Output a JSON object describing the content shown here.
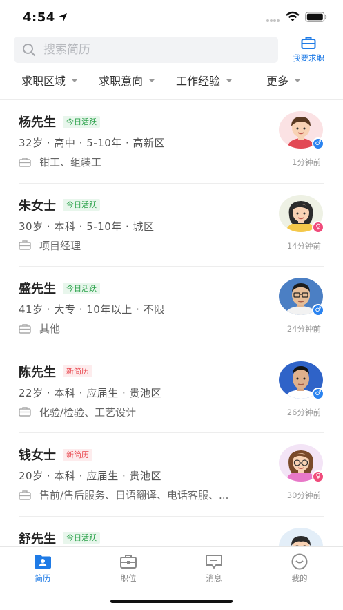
{
  "status_bar": {
    "time": "4:54"
  },
  "search": {
    "placeholder": "搜索简历"
  },
  "header_action": {
    "label": "我要求职"
  },
  "filters": [
    "求职区域",
    "求职意向",
    "工作经验",
    "更多"
  ],
  "candidates": [
    {
      "name": "杨先生",
      "tag": "今日活跃",
      "tag_type": "active",
      "info": "32岁 · 高中 · 5-10年 · 高新区",
      "job": "钳工、组装工",
      "time": "1分钟前",
      "gender": "male",
      "gender_symbol": "♂"
    },
    {
      "name": "朱女士",
      "tag": "今日活跃",
      "tag_type": "active",
      "info": "30岁 · 本科 · 5-10年 · 城区",
      "job": "项目经理",
      "time": "14分钟前",
      "gender": "female",
      "gender_symbol": "♀"
    },
    {
      "name": "盛先生",
      "tag": "今日活跃",
      "tag_type": "active",
      "info": "41岁 · 大专 · 10年以上 · 不限",
      "job": "其他",
      "time": "24分钟前",
      "gender": "male",
      "gender_symbol": "♂"
    },
    {
      "name": "陈先生",
      "tag": "新简历",
      "tag_type": "new",
      "info": "22岁 · 本科 · 应届生 · 贵池区",
      "job": "化验/检验、工艺设计",
      "time": "26分钟前",
      "gender": "male",
      "gender_symbol": "♂"
    },
    {
      "name": "钱女士",
      "tag": "新简历",
      "tag_type": "new",
      "info": "20岁 · 本科 · 应届生 · 贵池区",
      "job": "售前/售后服务、日语翻译、电话客服、...",
      "time": "30分钟前",
      "gender": "female",
      "gender_symbol": "♀"
    },
    {
      "name": "舒先生",
      "tag": "今日活跃",
      "tag_type": "active",
      "info": "",
      "job": "",
      "time": "",
      "gender": "male",
      "gender_symbol": ""
    }
  ],
  "tabbar": [
    {
      "label": "简历",
      "icon": "resume-icon",
      "active": true
    },
    {
      "label": "职位",
      "icon": "briefcase-icon",
      "active": false
    },
    {
      "label": "消息",
      "icon": "message-icon",
      "active": false
    },
    {
      "label": "我的",
      "icon": "profile-icon",
      "active": false
    }
  ],
  "colors": {
    "accent": "#1f7be6",
    "active_tag": "#2aa24a",
    "new_tag": "#e9484f",
    "male": "#2a83f0",
    "female": "#f04b7b"
  }
}
